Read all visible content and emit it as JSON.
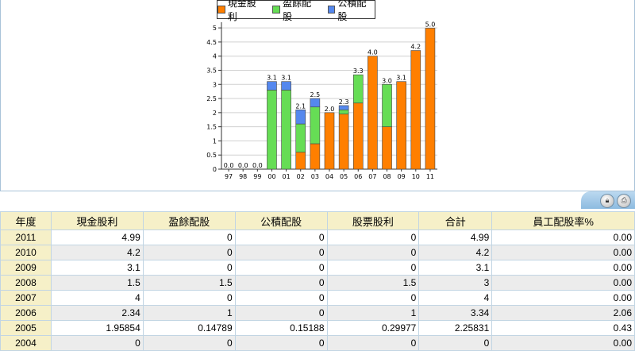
{
  "legend": [
    {
      "label": "現金股利",
      "color": "#ff7f00"
    },
    {
      "label": "盈餘配股",
      "color": "#66dd55"
    },
    {
      "label": "公積配股",
      "color": "#5588ee"
    }
  ],
  "chart_data": {
    "type": "bar",
    "stacked": true,
    "categories": [
      "97",
      "98",
      "99",
      "00",
      "01",
      "02",
      "03",
      "04",
      "05",
      "06",
      "07",
      "08",
      "09",
      "10",
      "11"
    ],
    "series": [
      {
        "name": "現金股利",
        "color": "#ff7f00",
        "values": [
          0,
          0,
          0,
          0,
          0,
          0.6,
          0.9,
          2.0,
          1.95,
          2.34,
          4.0,
          1.5,
          3.1,
          4.2,
          4.99
        ]
      },
      {
        "name": "盈餘配股",
        "color": "#66dd55",
        "values": [
          0,
          0,
          0,
          2.8,
          2.8,
          1.0,
          1.3,
          0,
          0.15,
          1.0,
          0,
          1.5,
          0,
          0,
          0
        ]
      },
      {
        "name": "公積配股",
        "color": "#5588ee",
        "values": [
          0,
          0,
          0,
          0.3,
          0.3,
          0.5,
          0.3,
          0,
          0.15,
          0,
          0,
          0,
          0,
          0,
          0
        ]
      }
    ],
    "totals": [
      "0.0",
      "0.0",
      "0.0",
      "3.1",
      "3.1",
      "2.1",
      "2.5",
      "2.0",
      "2.3",
      "3.3",
      "4.0",
      "3.0",
      "3.1",
      "4.2",
      "5.0"
    ],
    "yticks": [
      "0",
      "0.5",
      "1",
      "1.5",
      "2",
      "2.5",
      "3",
      "3.5",
      "4",
      "4.5",
      "5"
    ],
    "ylim": [
      0,
      5.2
    ],
    "grid": true,
    "legend_position": "top"
  },
  "toolbar": {
    "lock_icon": "lock-icon",
    "print_icon": "print-icon"
  },
  "table": {
    "headers": [
      "年度",
      "現金股利",
      "盈餘配股",
      "公積配股",
      "股票股利",
      "合計",
      "員工配股率%"
    ],
    "rows": [
      [
        "2011",
        "4.99",
        "0",
        "0",
        "0",
        "4.99",
        "0.00"
      ],
      [
        "2010",
        "4.2",
        "0",
        "0",
        "0",
        "4.2",
        "0.00"
      ],
      [
        "2009",
        "3.1",
        "0",
        "0",
        "0",
        "3.1",
        "0.00"
      ],
      [
        "2008",
        "1.5",
        "1.5",
        "0",
        "1.5",
        "3",
        "0.00"
      ],
      [
        "2007",
        "4",
        "0",
        "0",
        "0",
        "4",
        "0.00"
      ],
      [
        "2006",
        "2.34",
        "1",
        "0",
        "1",
        "3.34",
        "2.06"
      ],
      [
        "2005",
        "1.95854",
        "0.14789",
        "0.15188",
        "0.29977",
        "2.25831",
        "0.43"
      ],
      [
        "2004",
        "0",
        "0",
        "0",
        "0",
        "0",
        "0.00"
      ]
    ]
  }
}
